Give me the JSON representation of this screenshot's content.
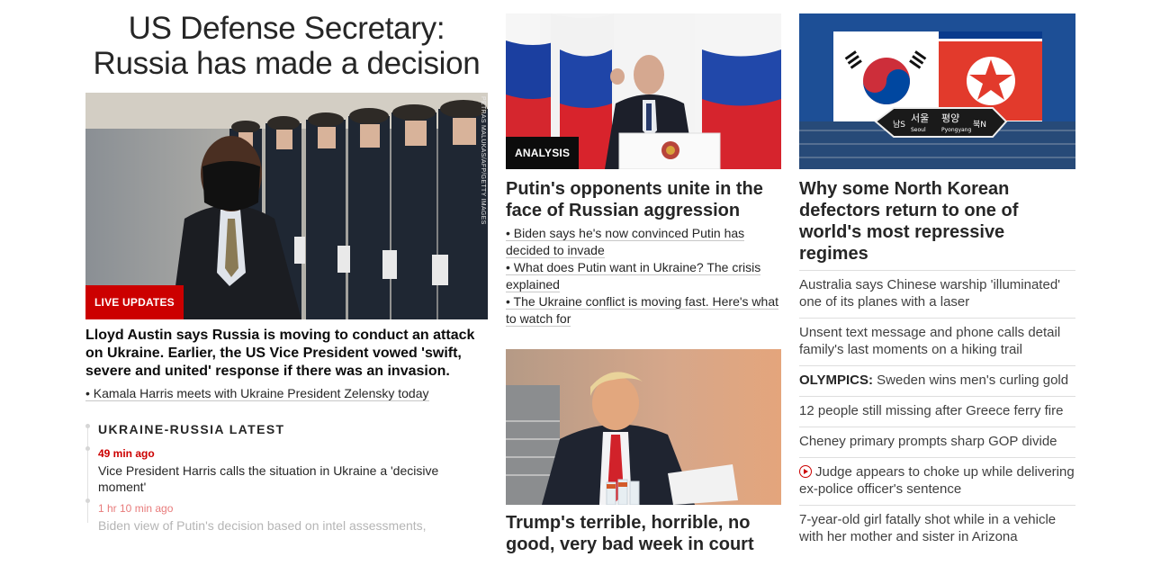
{
  "main": {
    "headline": "US Defense Secretary: Russia has made a decision",
    "image_label": "LIVE UPDATES",
    "image_credit": "PETRAS MALUKAS/AFP/GETTY IMAGES",
    "lead": "Lloyd Austin says Russia is moving to conduct an attack on Ukraine. Earlier, the US Vice President vowed 'swift, severe and united' response if there was an invasion.",
    "related": "• Kamala Harris meets with Ukraine President Zelensky today",
    "latest": {
      "title": "UKRAINE-RUSSIA LATEST",
      "items": [
        {
          "time": "49 min ago",
          "text": "Vice President Harris calls the situation in Ukraine a 'decisive moment'"
        },
        {
          "time": "1 hr 10 min ago",
          "text": "Biden view of Putin's decision based on intel assessments,"
        }
      ]
    }
  },
  "center": {
    "story1": {
      "label": "ANALYSIS",
      "headline": "Putin's opponents unite in the face of Russian aggression",
      "links": [
        "• Biden says he's now convinced Putin has decided to invade",
        "• What does Putin want in Ukraine? The crisis explained",
        "• The Ukraine conflict is moving fast. Here's what to watch for"
      ]
    },
    "story2": {
      "headline": "Trump's terrible, horrible, no good, very bad week in court"
    }
  },
  "right": {
    "image_sign": {
      "left_ko": "남S",
      "seoul_ko": "서울",
      "seoul": "Seoul",
      "pyongyang_ko": "평양",
      "pyongyang": "Pyongyang",
      "right_ko": "북N"
    },
    "headline": "Why some North Korean defectors return to one of world's most repressive regimes",
    "items": [
      {
        "text": "Australia says Chinese warship 'illuminated' one of its planes with a laser"
      },
      {
        "text": "Unsent text message and phone calls detail family's last moments on a hiking trail"
      },
      {
        "prefix": "OLYMPICS:",
        "text": " Sweden wins men's curling gold"
      },
      {
        "text": "12 people still missing after Greece ferry fire"
      },
      {
        "text": "Cheney primary prompts sharp GOP divide"
      },
      {
        "video": true,
        "text": "Judge appears to choke up while delivering ex-police officer's sentence"
      },
      {
        "text": "7-year-old girl fatally shot while in a vehicle with her mother and sister in Arizona"
      }
    ]
  },
  "colors": {
    "accent_red": "#cc0000",
    "text": "#262626",
    "divider": "#dedede"
  }
}
